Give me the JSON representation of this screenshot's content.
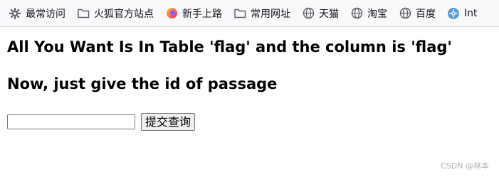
{
  "bookmarks": [
    {
      "label": "最常访问",
      "icon": "gear-icon"
    },
    {
      "label": "火狐官方站点",
      "icon": "folder-icon"
    },
    {
      "label": "新手上路",
      "icon": "firefox-icon"
    },
    {
      "label": "常用网址",
      "icon": "folder-icon"
    },
    {
      "label": "天猫",
      "icon": "globe-icon"
    },
    {
      "label": "淘宝",
      "icon": "globe-icon"
    },
    {
      "label": "百度",
      "icon": "globe-icon"
    },
    {
      "label": "Int",
      "icon": "extension-icon"
    }
  ],
  "page": {
    "heading1": "All You Want Is In Table 'flag' and the column is 'flag'",
    "heading2": "Now, just give the id of passage",
    "input_value": "",
    "submit_label": "提交查询"
  },
  "watermark": "CSDN @林本",
  "colors": {
    "bookmark_bar_bg": "#f9f9fb",
    "firefox_orange": "#ff7139",
    "firefox_purple": "#9059ff",
    "extension_blue": "#5b9bd5"
  }
}
